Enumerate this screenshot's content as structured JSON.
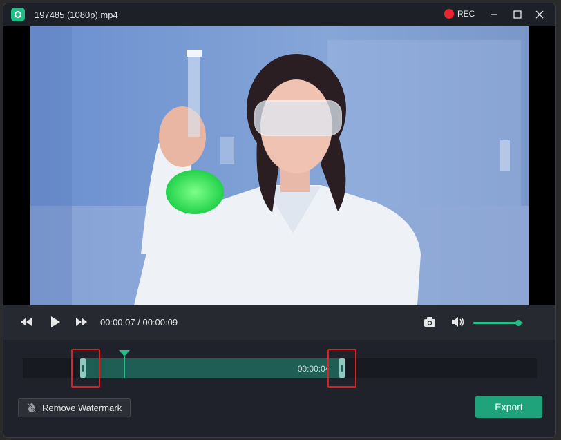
{
  "window": {
    "title": "197485 (1080p).mp4",
    "rec_label": "REC"
  },
  "player": {
    "current_time": "00:00:07",
    "separator": "/",
    "total_time": "00:00:09",
    "volume_fraction": 0.9
  },
  "trim": {
    "selected_duration": "00:00:04",
    "start_fraction": 0.122,
    "end_fraction": 0.626,
    "playhead_fraction": 0.198
  },
  "footer": {
    "remove_watermark_label": "Remove Watermark",
    "export_label": "Export"
  },
  "colors": {
    "accent": "#1fbf86",
    "rec": "#e5262e",
    "export": "#1ea37b",
    "highlight": "#e02020"
  }
}
